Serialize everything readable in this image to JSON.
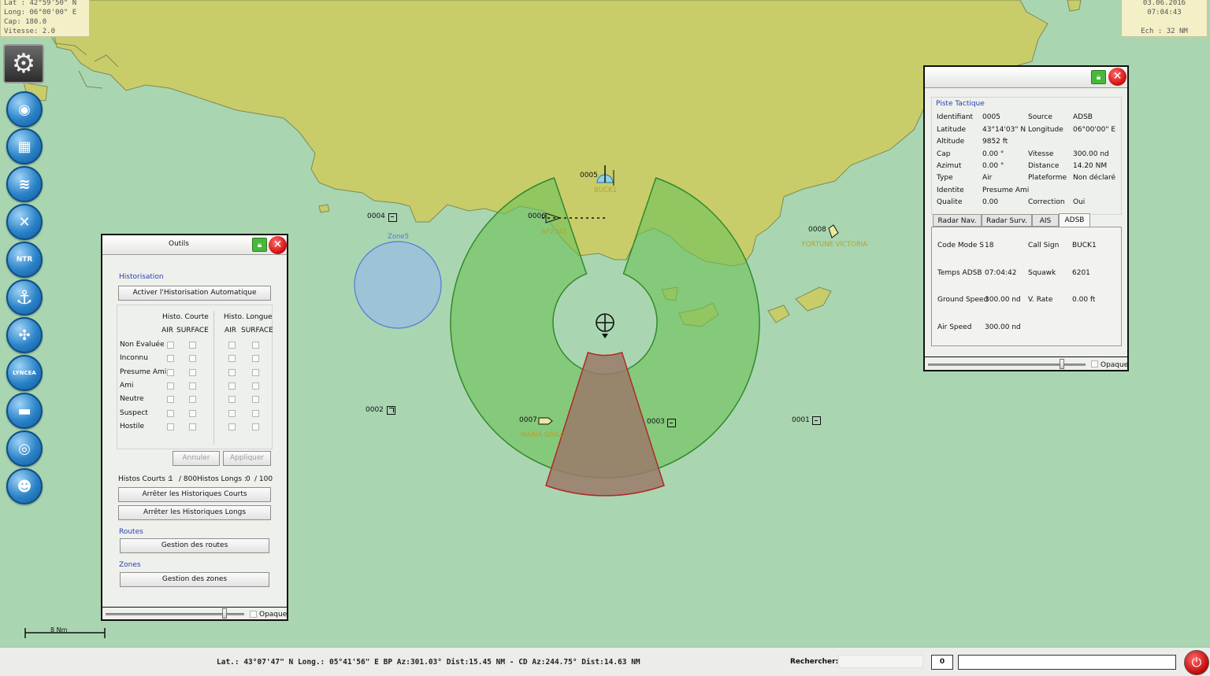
{
  "info_top_left": {
    "lat": "Lat : 42°59'50\" N",
    "long": "Long: 06°00'00\" E",
    "cap": "Cap: 180.0",
    "vitesse": "Vitesse:   2.0"
  },
  "info_top_right": {
    "date": "03.06.2016",
    "time": "07:04:43",
    "scale": "Ech : 32 NM"
  },
  "toolbar": {
    "buttons": [
      {
        "icon": "settings-gear-icon"
      },
      {
        "icon": "eye-monitor-icon"
      },
      {
        "icon": "building-map-icon"
      },
      {
        "icon": "layers-icon"
      },
      {
        "icon": "tools-icon"
      },
      {
        "icon": "ntr-route-icon",
        "text": "NTR"
      },
      {
        "icon": "anchor-icon"
      },
      {
        "icon": "compass-icon"
      },
      {
        "icon": "lyncea-icon",
        "text": "LYNCEA"
      },
      {
        "icon": "tank-icon"
      },
      {
        "icon": "camera-icon"
      },
      {
        "icon": "operator-icon"
      }
    ]
  },
  "map": {
    "zone": {
      "label": "Zone5"
    },
    "tracks": [
      {
        "id": "0005",
        "name": "BUCK1"
      },
      {
        "id": "0004",
        "name": ""
      },
      {
        "id": "0006",
        "name": "AP2345"
      },
      {
        "id": "0008",
        "name": "FORTUNE VICTORIA"
      },
      {
        "id": "0002",
        "name": ""
      },
      {
        "id": "0007",
        "name": "MARIA GRAZ"
      },
      {
        "id": "0003",
        "name": ""
      },
      {
        "id": "0001",
        "name": ""
      }
    ],
    "scale_bar": "8 Nm"
  },
  "outils": {
    "title": "Outils",
    "historisation_title": "Historisation",
    "activate_button": "Activer l'Historisation Automatique",
    "histo_courte": "Histo. Courte",
    "histo_longue": "Histo. Longue",
    "col_air": "AIR",
    "col_surface": "SURFACE",
    "rows": [
      "Non Evaluée",
      "Inconnu",
      "Presume Ami",
      "Ami",
      "Neutre",
      "Suspect",
      "Hostile"
    ],
    "annuler": "Annuler",
    "appliquer": "Appliquer",
    "counts": {
      "courts_label": "Histos Courts :",
      "courts_value": "1",
      "courts_max": "/ 800",
      "longs_label": "Histos Longs :",
      "longs_value": "0",
      "longs_max": "/ 100"
    },
    "stop_courts": "Arrêter les Historiques Courts",
    "stop_longs": "Arrêter les Historiques Longs",
    "routes_title": "Routes",
    "routes_button": "Gestion des routes",
    "zones_title": "Zones",
    "zones_button": "Gestion des zones",
    "opaque": "Opaque"
  },
  "piste": {
    "section_title": "Piste Tactique",
    "fields": [
      {
        "l1": "Identifiant",
        "v1": "0005",
        "l2": "Source",
        "v2": "ADSB"
      },
      {
        "l1": "Latitude",
        "v1": "43°14'03\" N",
        "l2": "Longitude",
        "v2": "06°00'00\" E"
      },
      {
        "l1": "Altitude",
        "v1": "9852 ft",
        "l2": "",
        "v2": ""
      },
      {
        "l1": "Cap",
        "v1": "0.00 °",
        "l2": "Vitesse",
        "v2": "300.00 nd"
      },
      {
        "l1": "Azimut",
        "v1": "0.00 °",
        "l2": "Distance",
        "v2": "14.20 NM"
      },
      {
        "l1": "Type",
        "v1": "Air",
        "l2": "Plateforme",
        "v2": "Non déclaré"
      },
      {
        "l1": "Identite",
        "v1": "Presume Ami",
        "l2": "",
        "v2": ""
      },
      {
        "l1": "Qualite",
        "v1": "0.00",
        "l2": "Correction",
        "v2": "Oui"
      }
    ],
    "tabs": [
      "Radar Nav.",
      "Radar Surv.",
      "AIS",
      "ADSB"
    ],
    "adsb": [
      {
        "l1": "Code Mode S",
        "v1": "18",
        "l2": "Call Sign",
        "v2": "BUCK1"
      },
      {
        "l1": "Temps ADSB",
        "v1": "07:04:42",
        "l2": "Squawk",
        "v2": "6201"
      },
      {
        "l1": "Ground Speed",
        "v1": "300.00 nd",
        "l2": "V. Rate",
        "v2": "0.00 ft"
      },
      {
        "l1": "Air Speed",
        "v1": "300.00 nd",
        "l2": "",
        "v2": ""
      }
    ],
    "opaque": "Opaque"
  },
  "status_bar": {
    "coords": "Lat.: 43°07'47\" N Long.: 05°41'56\" E BP Az:301.03° Dist:15.45 NM - CD Az:244.75° Dist:14.63 NM",
    "search_label": "Rechercher:",
    "search_value": "",
    "counter": "0",
    "message": ""
  },
  "colors": {
    "sea": "#a9d6b1",
    "land": "#c8cd6a",
    "radar_coverage": "#6fc15a",
    "blind_sector": "#9a7a6a",
    "zone_fill": "#9ec2d6",
    "accent_blue": "#2a3fb0",
    "close_red": "#d31010",
    "lock_green": "#49b83a"
  }
}
